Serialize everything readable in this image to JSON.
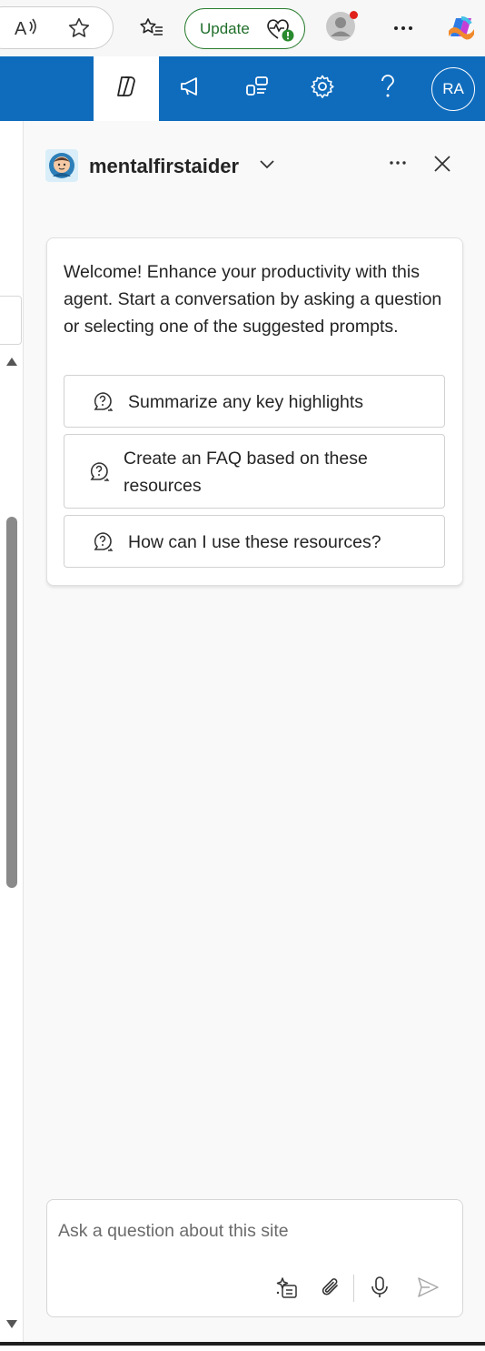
{
  "browser": {
    "update_label": "Update",
    "icons": [
      "read-aloud-icon",
      "favorite-star-icon",
      "favorites-list-icon",
      "health-heart-icon",
      "profile-icon",
      "more-icon",
      "copilot-icon"
    ]
  },
  "app_bar": {
    "tabs": [
      "copilot-icon",
      "megaphone-icon",
      "sections-icon",
      "settings-icon",
      "help-icon"
    ],
    "avatar_initials": "RA",
    "color": "#0f6cbd"
  },
  "agent": {
    "name": "mentalfirstaider"
  },
  "welcome": {
    "message": "Welcome! Enhance your productivity with this agent. Start a conversation by asking a question or selecting one of the suggested prompts.",
    "prompts": [
      {
        "label": "Summarize any key highlights"
      },
      {
        "label": "Create an FAQ based on these resources"
      },
      {
        "label": "How can I use these resources?"
      }
    ]
  },
  "composer": {
    "placeholder": "Ask a question about this site",
    "value": ""
  }
}
